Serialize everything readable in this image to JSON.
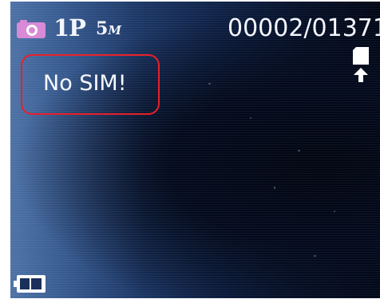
{
  "status_bar": {
    "camera_mode_icon": "camera-icon",
    "shot_count": "1P",
    "resolution_value": "5",
    "resolution_unit": "M",
    "file_counter": "00002/01371",
    "storage_icon": "sd-card-upload-icon"
  },
  "message": {
    "text": "No SIM!"
  },
  "annotation": {
    "border_color": "#e8202a"
  },
  "footer": {
    "battery_icon": "battery-icon"
  },
  "colors": {
    "text": "#f4f6ff",
    "camera_icon": "#d88ad6",
    "screen_left": "#40669c",
    "screen_right": "#020714"
  }
}
